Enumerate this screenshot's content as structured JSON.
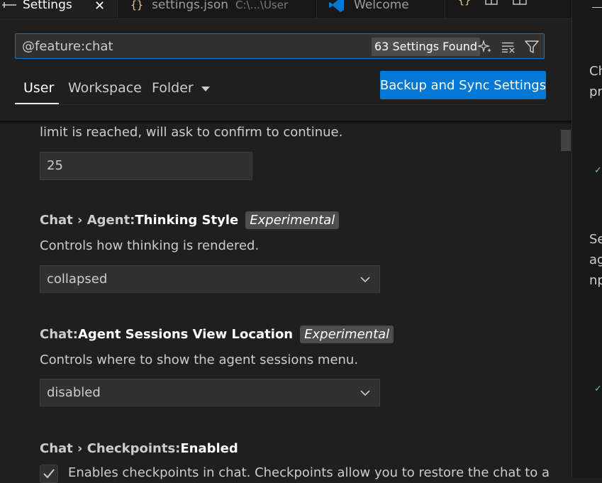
{
  "tabs": [
    {
      "label": "Settings",
      "close_glyph": "✕"
    },
    {
      "label": "settings.json",
      "path": "C:\\...\\User"
    },
    {
      "label": "Welcome"
    }
  ],
  "header": {
    "search": {
      "value": "@feature:chat"
    },
    "count": "63 Settings Found",
    "scopes": [
      "User",
      "Workspace",
      "Folder"
    ],
    "sync_button": "Backup and Sync Settings"
  },
  "settings": [
    {
      "desc_partial": "limit is reached, will ask to confirm to continue.",
      "value": "25"
    },
    {
      "category": "Chat › Agent: ",
      "name": "Thinking Style",
      "badge": "Experimental",
      "description": "Controls how thinking is rendered.",
      "value": "collapsed"
    },
    {
      "category": "Chat: ",
      "name": "Agent Sessions View Location",
      "badge": "Experimental",
      "description": "Controls where to show the agent sessions menu.",
      "value": "disabled"
    },
    {
      "category": "Chat › Checkpoints: ",
      "name": "Enabled",
      "description": "Enables checkpoints in chat. Checkpoints allow you to restore the chat to a",
      "checked": true
    }
  ],
  "right_panel": {
    "lines_a": [
      "Ch",
      "pr"
    ],
    "lines_b": [
      "Se",
      "ag",
      "np"
    ]
  },
  "colors": {
    "accent": "#0078d4",
    "background": "#1f1f1f",
    "badge": "#4d4d4d"
  }
}
